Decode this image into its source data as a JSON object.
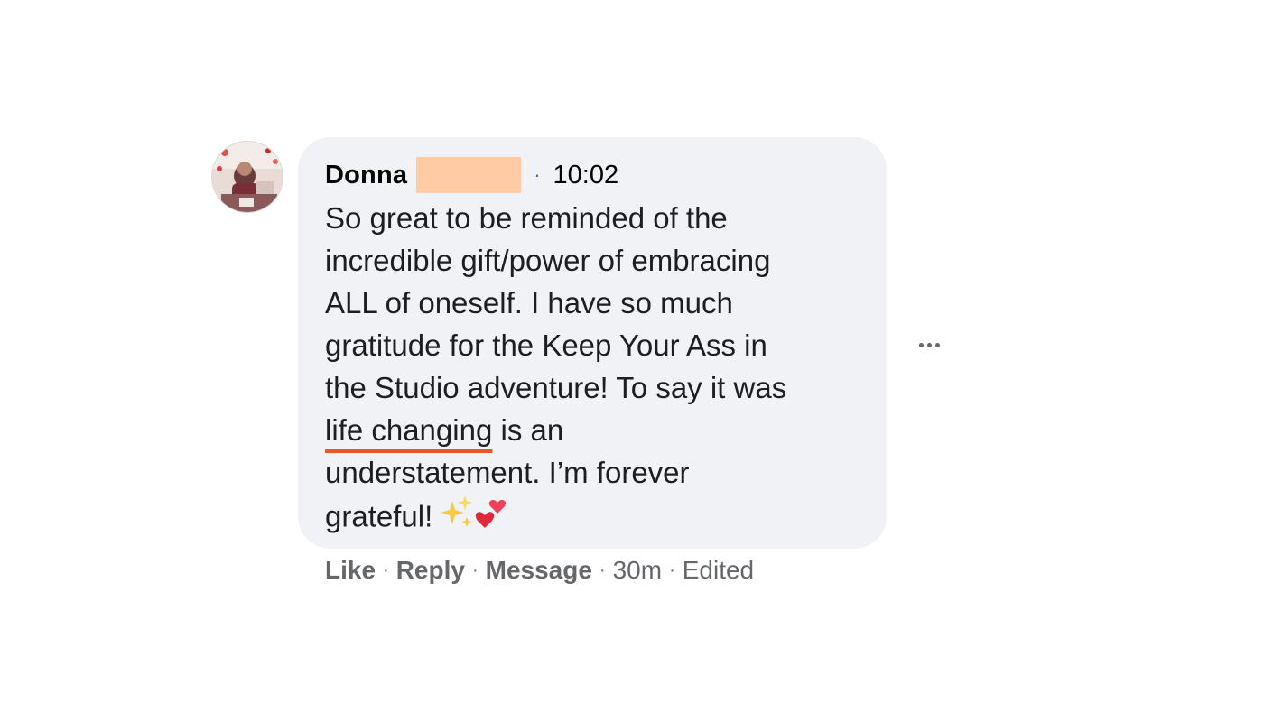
{
  "comment": {
    "author": "Donna",
    "time": "10:02",
    "separator": "·",
    "lines": [
      "So great to be reminded of the",
      "incredible gift/power of embracing",
      "ALL of oneself. I have so much",
      "gratitude for the Keep Your Ass in",
      "the Studio adventure! To say it was"
    ],
    "underlined_text": "life changing",
    "after_underline": " is an",
    "line_after": "understatement. I’m forever",
    "last_line": "grateful!",
    "emojis": [
      "sparkles-emoji",
      "two-hearts-emoji"
    ]
  },
  "actions": {
    "like": "Like",
    "reply": "Reply",
    "message": "Message",
    "age": "30m",
    "edited": "Edited",
    "separator": "·"
  },
  "icons": {
    "more": "more-options-icon",
    "avatar": "user-avatar"
  },
  "colors": {
    "bubble": "#f0f2f5",
    "underline": "#e8562a",
    "redaction": "#ffcba4",
    "meta_text": "#65676b"
  }
}
